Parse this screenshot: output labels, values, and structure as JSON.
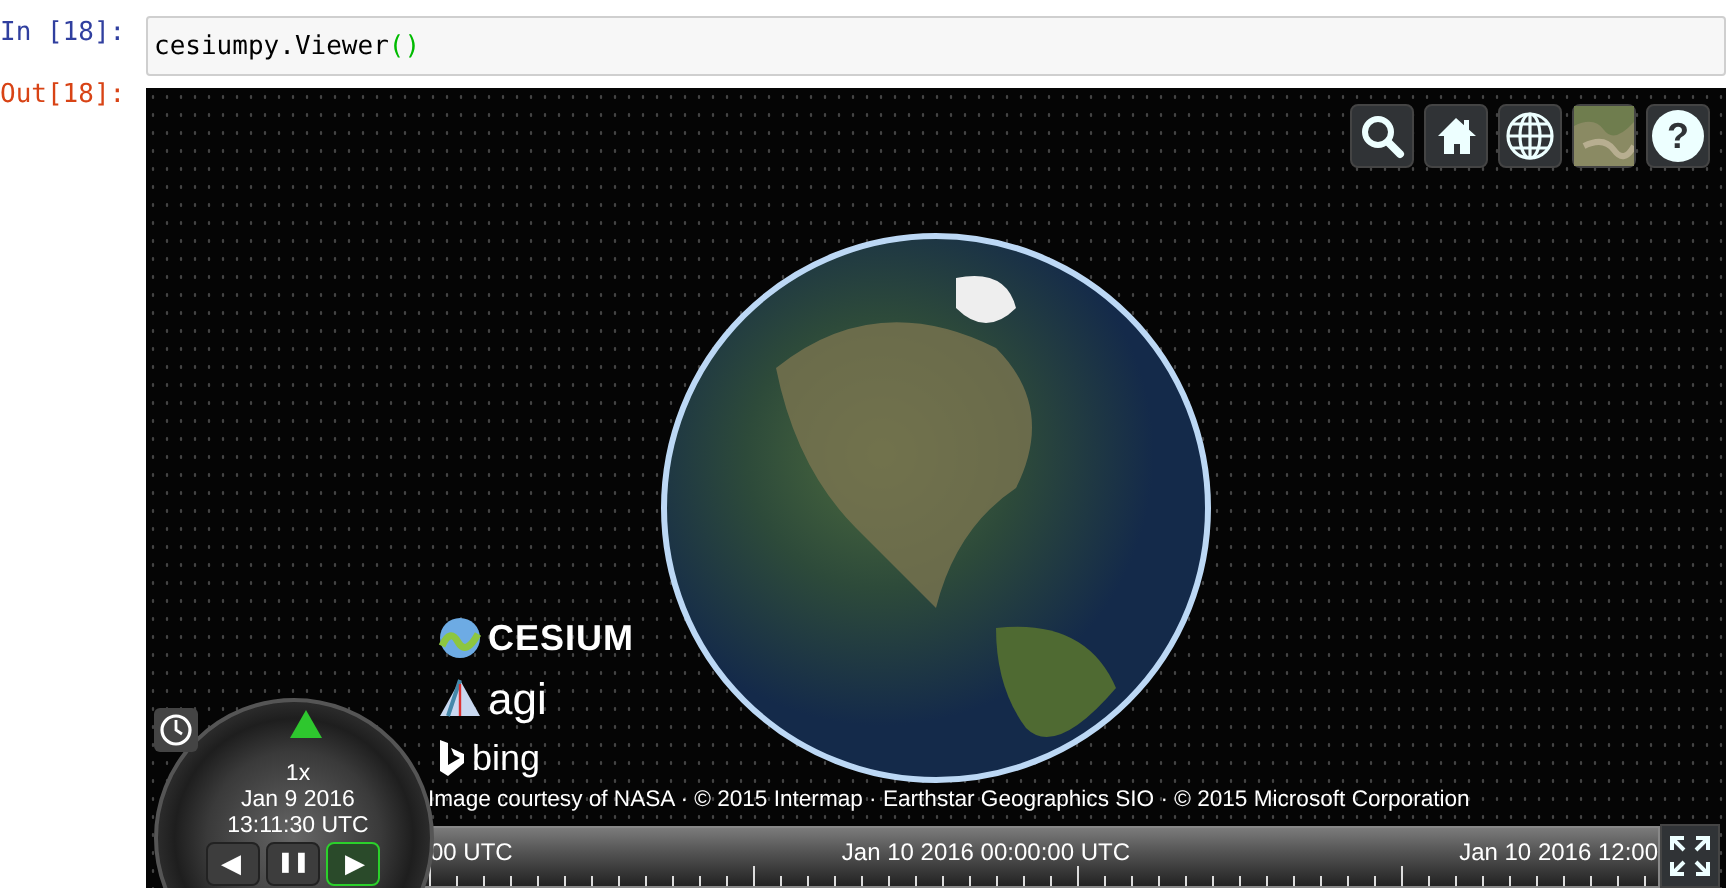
{
  "input_cell": {
    "prompt": "In [18]:",
    "code": [
      {
        "text": "cesiumpy.Viewer",
        "kind": "name"
      },
      {
        "text": "()",
        "kind": "bracket"
      }
    ]
  },
  "output_cell": {
    "prompt": "Out[18]:"
  },
  "viewer": {
    "toolbar": [
      {
        "kind": "search"
      },
      {
        "kind": "home"
      },
      {
        "kind": "globe"
      },
      {
        "kind": "imagery"
      },
      {
        "kind": "help",
        "label": "?"
      }
    ],
    "logos": [
      {
        "kind": "cesium",
        "label": "CESIUM"
      },
      {
        "kind": "agi",
        "label": "agi"
      },
      {
        "kind": "bing",
        "label": "bing"
      }
    ],
    "credits": "Image courtesy of NASA · © 2015 Intermap · Earthstar Geographics SIO · © 2015 Microsoft Corporation",
    "animation": {
      "speed": "1x",
      "date": "Jan 9 2016",
      "time": "13:11:30 UTC",
      "buttons": [
        {
          "kind": "reverse",
          "label": "◀",
          "selected": false
        },
        {
          "kind": "pause",
          "label": "❚❚",
          "selected": false
        },
        {
          "kind": "play",
          "label": "▶",
          "selected": true
        }
      ]
    },
    "timeline": {
      "labels": [
        "00 UTC",
        "Jan 10 2016 00:00:00 UTC",
        "Jan 10 2016 12:00"
      ]
    }
  }
}
